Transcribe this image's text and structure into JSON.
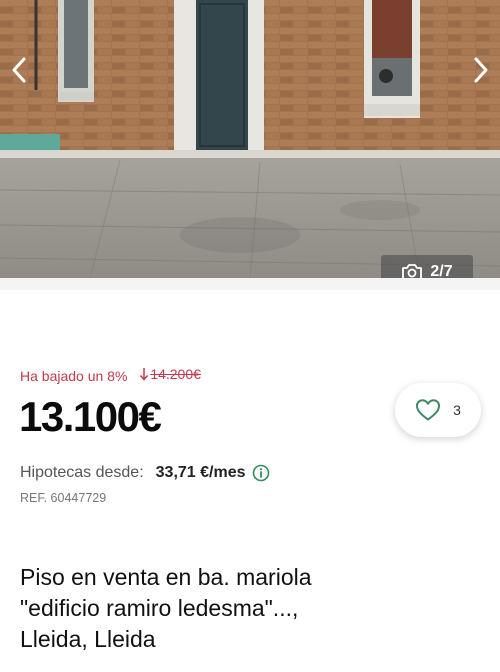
{
  "gallery": {
    "counter_text": "2/7",
    "icons": {
      "prev": "chevron-left-icon",
      "next": "chevron-right-icon",
      "camera": "camera-icon"
    }
  },
  "listing": {
    "price_drop_label": "Ha bajado un 8%",
    "old_price": "14.200€",
    "price": "13.100€",
    "favorites_count": "3",
    "mortgage_label": "Hipotecas desde:",
    "mortgage_value": "33,71 €/mes",
    "reference": "REF. 60447729",
    "title": "Piso en venta en ba. mariola \"edificio ramiro ledesma\"..., Lleida, Lleida"
  },
  "colors": {
    "price_drop": "#c23a4c",
    "info_icon": "#2f8f5b",
    "heart_icon": "#3d8a62"
  }
}
